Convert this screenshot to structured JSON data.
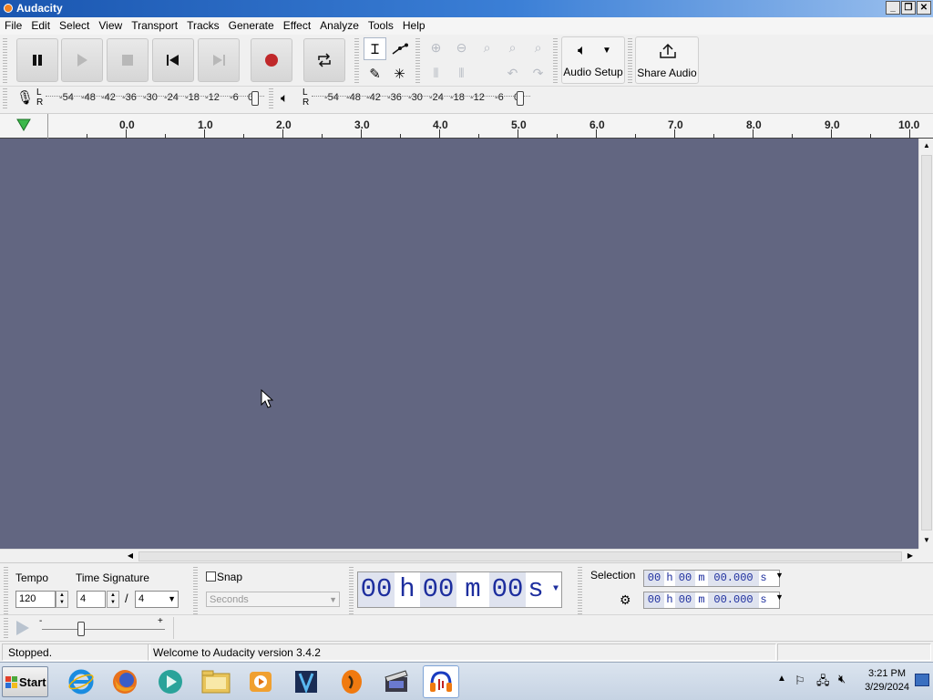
{
  "window": {
    "title": "Audacity"
  },
  "menu": [
    "File",
    "Edit",
    "Select",
    "View",
    "Transport",
    "Tracks",
    "Generate",
    "Effect",
    "Analyze",
    "Tools",
    "Help"
  ],
  "toolbar": {
    "audio_setup_label": "Audio Setup",
    "share_audio_label": "Share Audio"
  },
  "meters": {
    "record_L": "L",
    "record_R": "R",
    "play_L": "L",
    "play_R": "R",
    "scale": [
      "-54",
      "-48",
      "-42",
      "-36",
      "-30",
      "-24",
      "-18",
      "-12",
      "-6",
      "0"
    ]
  },
  "ruler": {
    "labels": [
      "0.0",
      "1.0",
      "2.0",
      "3.0",
      "4.0",
      "5.0",
      "6.0",
      "7.0",
      "8.0",
      "9.0",
      "10.0"
    ]
  },
  "tempo": {
    "label": "Tempo",
    "value": "120"
  },
  "time_signature": {
    "label": "Time Signature",
    "numerator": "4",
    "separator": "/",
    "denominator": "4"
  },
  "snap": {
    "label": "Snap",
    "checked": false,
    "units_placeholder": "Seconds"
  },
  "time_display": {
    "h": "00",
    "h_unit": "h",
    "m": "00",
    "m_unit": "m",
    "s": "00",
    "s_unit": "s"
  },
  "selection": {
    "label": "Selection",
    "start": {
      "h": "00",
      "m": "00",
      "s": "00.000",
      "h_unit": "h",
      "m_unit": "m",
      "s_unit": "s"
    },
    "end": {
      "h": "00",
      "m": "00",
      "s": "00.000",
      "h_unit": "h",
      "m_unit": "m",
      "s_unit": "s"
    }
  },
  "playat": {
    "minus": "-",
    "plus": "+"
  },
  "status": {
    "state": "Stopped.",
    "message": "Welcome to Audacity version 3.4.2"
  },
  "taskbar": {
    "start_label": "Start",
    "apps": [
      "internet-explorer",
      "firefox",
      "media-app",
      "file-explorer",
      "media-player",
      "video-editor",
      "fl-studio",
      "movie-maker",
      "audacity"
    ],
    "time": "3:21 PM",
    "date": "3/29/2024"
  },
  "colors": {
    "track_bg": "#626681",
    "record_red": "#c0282a",
    "time_digits": "#1d2e9e"
  }
}
